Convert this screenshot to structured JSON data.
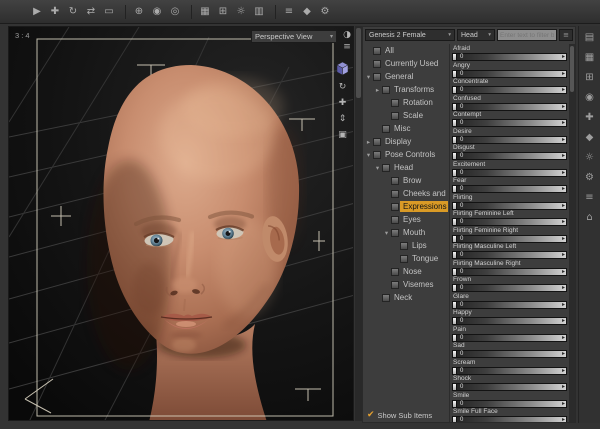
{
  "glyphs": {
    "caret": "▾",
    "check": "✔",
    "nudge_right": "▸",
    "draw_style": "◑",
    "viewport_menu": "≡",
    "orbit": "↻",
    "pan": "✚",
    "dolly": "⇕",
    "frame": "▣"
  },
  "colors": {
    "accent": "#d99a26",
    "panel": "#3d3d3d",
    "viewport_bg": "#0d0d0d"
  },
  "top_toolbar": {
    "icons": [
      {
        "name": "pointer-tool",
        "glyph": "▶"
      },
      {
        "name": "universal-manipulator",
        "glyph": "✚"
      },
      {
        "name": "rotate-tool",
        "glyph": "↻"
      },
      {
        "name": "translate-tool",
        "glyph": "⇄"
      },
      {
        "name": "scale-tool",
        "glyph": "▭"
      },
      {
        "name": "separator",
        "sep": true
      },
      {
        "name": "active-pose-tool",
        "glyph": "⊕"
      },
      {
        "name": "node-selection-tool",
        "glyph": "◉"
      },
      {
        "name": "geometry-selection-tool",
        "glyph": "◎"
      },
      {
        "name": "separator",
        "sep": true
      },
      {
        "name": "scene-navigator",
        "glyph": "▦"
      },
      {
        "name": "aux-viewport",
        "glyph": "⊞"
      },
      {
        "name": "render-button",
        "glyph": "☼"
      },
      {
        "name": "spot-render-button",
        "glyph": "▥"
      },
      {
        "name": "separator",
        "sep": true
      },
      {
        "name": "timeline-toggle",
        "glyph": "≡"
      },
      {
        "name": "shader-mixer",
        "glyph": "◆"
      },
      {
        "name": "preferences",
        "glyph": "⚙"
      }
    ]
  },
  "viewport": {
    "aspect_label": "3 : 4",
    "view_selector": {
      "label": "Perspective View"
    }
  },
  "parameters_panel": {
    "figure_selector": "Genesis 2 Female",
    "node_selector": "Head",
    "filter_placeholder": "Enter text to filter by",
    "show_sub_items_label": "Show Sub Items",
    "tree": [
      {
        "label": "All",
        "level": 0
      },
      {
        "label": "Currently Used",
        "level": 0
      },
      {
        "label": "General",
        "level": 0,
        "arrow": "down"
      },
      {
        "label": "Transforms",
        "level": 1,
        "arrow": "right"
      },
      {
        "label": "Rotation",
        "level": 2
      },
      {
        "label": "Scale",
        "level": 2
      },
      {
        "label": "Misc",
        "level": 1
      },
      {
        "label": "Display",
        "level": 0,
        "arrow": "right"
      },
      {
        "label": "Pose Controls",
        "level": 0,
        "arrow": "down"
      },
      {
        "label": "Head",
        "level": 1,
        "arrow": "down"
      },
      {
        "label": "Brow",
        "level": 2
      },
      {
        "label": "Cheeks and Jaw",
        "level": 2
      },
      {
        "label": "Expressions",
        "level": 2,
        "selected": true
      },
      {
        "label": "Eyes",
        "level": 2
      },
      {
        "label": "Mouth",
        "level": 2,
        "arrow": "down"
      },
      {
        "label": "Lips",
        "level": 3
      },
      {
        "label": "Tongue",
        "level": 3
      },
      {
        "label": "Nose",
        "level": 2
      },
      {
        "label": "Visemes",
        "level": 2
      },
      {
        "label": "Neck",
        "level": 1
      }
    ],
    "sliders": [
      {
        "label": "Afraid",
        "value": "0"
      },
      {
        "label": "Angry",
        "value": "0"
      },
      {
        "label": "Concentrate",
        "value": "0"
      },
      {
        "label": "Confused",
        "value": "0"
      },
      {
        "label": "Contempt",
        "value": "0"
      },
      {
        "label": "Desire",
        "value": "0"
      },
      {
        "label": "Disgust",
        "value": "0"
      },
      {
        "label": "Excitement",
        "value": "0"
      },
      {
        "label": "Fear",
        "value": "0"
      },
      {
        "label": "Flirting",
        "value": "0"
      },
      {
        "label": "Flirting Feminine Left",
        "value": "0"
      },
      {
        "label": "Flirting Feminine Right",
        "value": "0"
      },
      {
        "label": "Flirting Masculine Left",
        "value": "0"
      },
      {
        "label": "Flirting Masculine Right",
        "value": "0"
      },
      {
        "label": "Frown",
        "value": "0"
      },
      {
        "label": "Glare",
        "value": "0"
      },
      {
        "label": "Happy",
        "value": "0"
      },
      {
        "label": "Pain",
        "value": "0"
      },
      {
        "label": "Sad",
        "value": "0"
      },
      {
        "label": "Scream",
        "value": "0"
      },
      {
        "label": "Shock",
        "value": "0"
      },
      {
        "label": "Smile",
        "value": "0"
      },
      {
        "label": "Smile Full Face",
        "value": "0"
      }
    ]
  },
  "right_dock": {
    "icons": [
      {
        "name": "scene-tab",
        "glyph": "▤"
      },
      {
        "name": "smart-content-tab",
        "glyph": "▦"
      },
      {
        "name": "parameters-tab",
        "glyph": "⊞"
      },
      {
        "name": "shaping-tab",
        "glyph": "◉"
      },
      {
        "name": "posing-tab",
        "glyph": "✚"
      },
      {
        "name": "surfaces-tab",
        "glyph": "◆"
      },
      {
        "name": "render-settings-tab",
        "glyph": "☼"
      },
      {
        "name": "simulation-settings-tab",
        "glyph": "⚙"
      },
      {
        "name": "content-library-tab",
        "glyph": "≡"
      },
      {
        "name": "hierarchy-tab",
        "glyph": "⌂"
      }
    ]
  }
}
